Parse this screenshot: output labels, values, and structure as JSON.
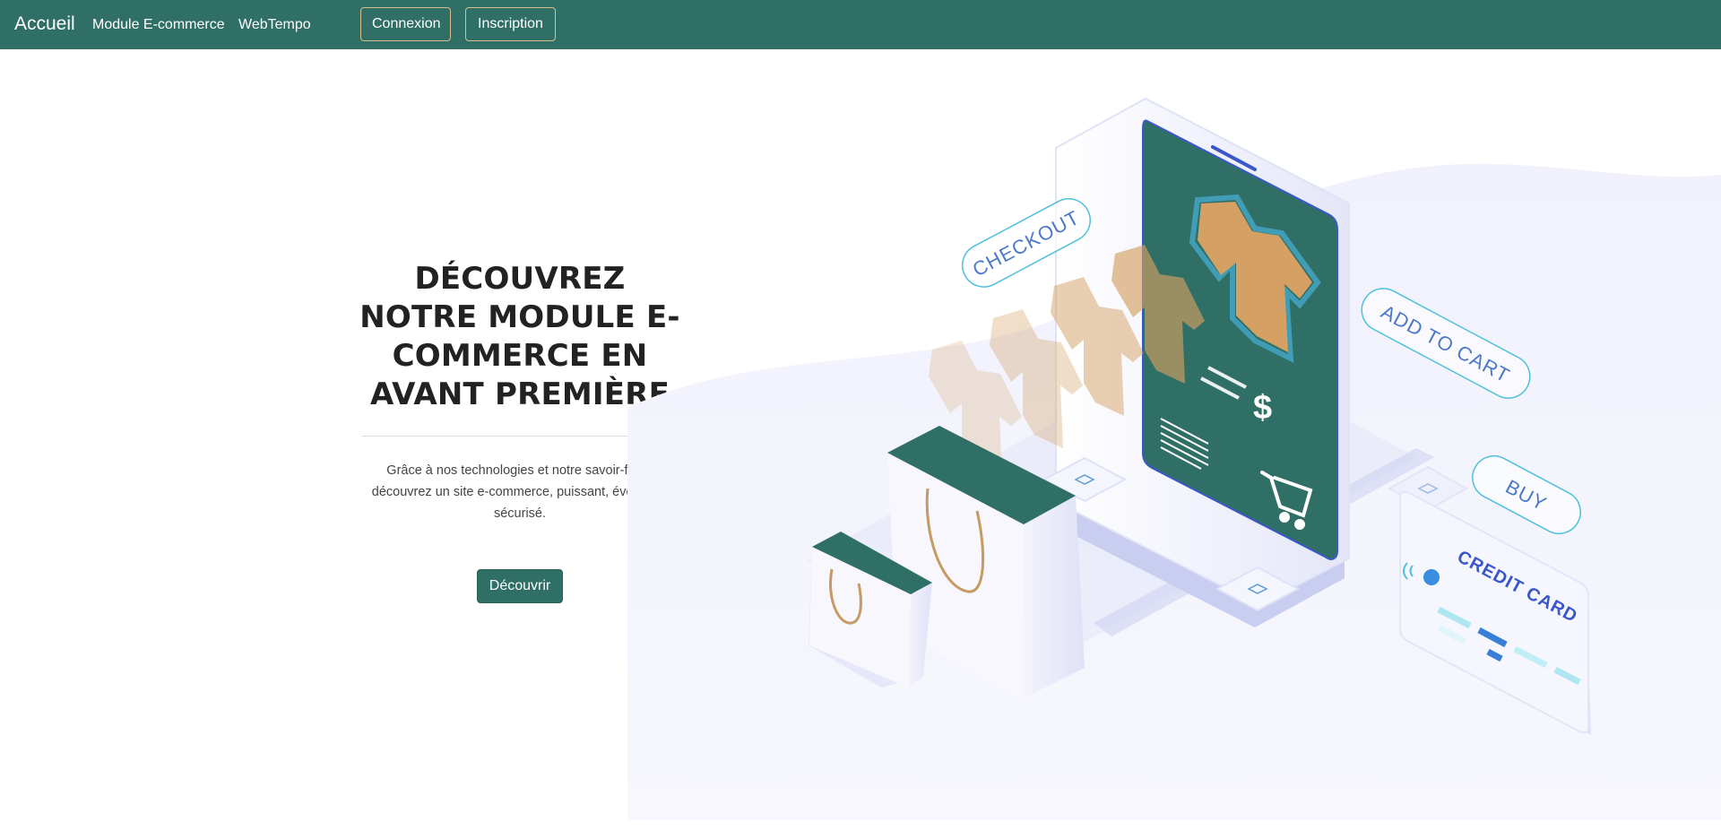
{
  "nav": {
    "brand": "Accueil",
    "links": [
      "Module E-commerce",
      "WebTempo"
    ],
    "login": "Connexion",
    "signup": "Inscription"
  },
  "hero": {
    "title": "DÉCOUVREZ NOTRE MODULE E-COMMERCE EN AVANT PREMIÈRE",
    "description": "Grâce à nos technologies et notre savoir-faire, découvrez un site e-commerce, puissant, évolutif et sécurisé.",
    "cta": "Découvrir"
  },
  "illustration": {
    "checkout": "CHECKOUT",
    "add_to_cart": "ADD TO CART",
    "buy": "BUY",
    "credit_card": "CREDIT CARD",
    "price_symbol": "$"
  },
  "colors": {
    "primary": "#2f6f66",
    "accent_border": "#d7c08c",
    "shirt": "#d4a063",
    "heading": "#222222",
    "text": "#444444"
  }
}
